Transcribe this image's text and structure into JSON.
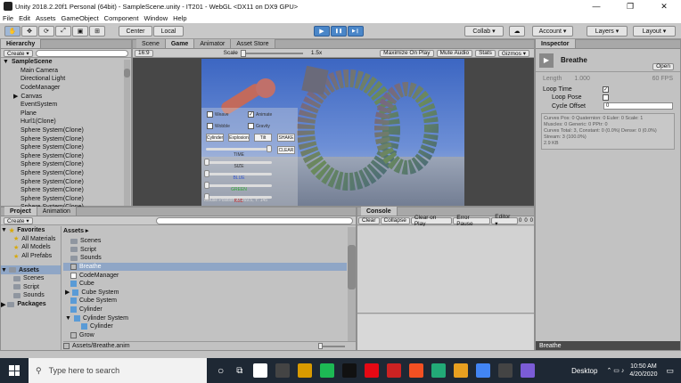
{
  "window": {
    "title": "Unity 2018.2.20f1 Personal (64bit) - SampleScene.unity - IT201 - WebGL <DX11 on DX9 GPU>",
    "min": "—",
    "max": "❐",
    "close": "✕"
  },
  "menu": [
    "File",
    "Edit",
    "Assets",
    "GameObject",
    "Component",
    "Window",
    "Help"
  ],
  "toolbar": {
    "pivot": "Center",
    "space": "Local",
    "collab": "Collab ▾",
    "account": "Account ▾",
    "layers": "Layers ▾",
    "layout": "Layout ▾",
    "cloud_icon": "cloud-icon",
    "play_icon": "▶",
    "pause_icon": "❚❚",
    "step_icon": "▶❙",
    "tool_icons": [
      "✋",
      "✥",
      "⟳",
      "⤢",
      "▣",
      "⊞"
    ]
  },
  "hierarchy": {
    "tab": "Hierarchy",
    "create": "Create ▾",
    "items": [
      {
        "label": "SampleScene",
        "indent": 0,
        "bold": true,
        "arrow": "▼"
      },
      {
        "label": "Main Camera",
        "indent": 1
      },
      {
        "label": "Directional Light",
        "indent": 1
      },
      {
        "label": "CodeManager",
        "indent": 1
      },
      {
        "label": "Canvas",
        "indent": 1,
        "arrow": "▶"
      },
      {
        "label": "EventSystem",
        "indent": 1
      },
      {
        "label": "Plane",
        "indent": 1
      },
      {
        "label": "Hurl1(Clone)",
        "indent": 1
      },
      {
        "label": "Sphere System(Clone)",
        "indent": 1
      },
      {
        "label": "Sphere System(Clone)",
        "indent": 1
      },
      {
        "label": "Sphere System(Clone)",
        "indent": 1
      },
      {
        "label": "Sphere System(Clone)",
        "indent": 1
      },
      {
        "label": "Sphere System(Clone)",
        "indent": 1
      },
      {
        "label": "Sphere System(Clone)",
        "indent": 1
      },
      {
        "label": "Sphere System(Clone)",
        "indent": 1
      },
      {
        "label": "Sphere System(Clone)",
        "indent": 1
      },
      {
        "label": "Sphere System(Clone)",
        "indent": 1
      },
      {
        "label": "Sphere System(Clone)",
        "indent": 1
      }
    ]
  },
  "center_tabs": [
    {
      "label": "Scene",
      "active": false
    },
    {
      "label": "Game",
      "active": true
    },
    {
      "label": "Animator",
      "active": false
    },
    {
      "label": "Asset Store",
      "active": false
    }
  ],
  "game_bar": {
    "aspect": "16:9",
    "scale_label": "Scale",
    "scale_value": "1.5x",
    "buttons": [
      "Maximize On Play",
      "Mute Audio",
      "Stats",
      "Gizmos ▾"
    ]
  },
  "game_ui": {
    "toggles": [
      "Weave",
      "Animate",
      "Wobble",
      "Gravity"
    ],
    "shape_buttons": [
      "Cylinder",
      "Explosion",
      "Tilt",
      "SHAKE"
    ],
    "clear": "CLEAR",
    "sliders": [
      "TIME",
      "SIZE",
      "BLUE",
      "GREEN",
      "RED"
    ],
    "mouse_pos": "Mouse Position X: 369.5, Y: 145"
  },
  "inspector": {
    "tab": "Inspector",
    "name": "Breathe",
    "open": "Open",
    "length_label": "Length",
    "length_value": "1.000",
    "fps": "60 FPS",
    "loop_time": "Loop Time",
    "loop_pose": "Loop Pose",
    "cycle_offset": "Cycle Offset",
    "cycle_value": "0",
    "info": "Curves Pos: 0 Quaternion: 0 Euler: 0 Scale: 1\nMuscles: 0 Generic: 0 PPtr: 0\nCurves Total: 3, Constant: 0 (0.0%) Dense: 0 (0.0%) Stream: 3 (100.0%)\n2.9 KB",
    "footer": "Breathe"
  },
  "bottom_tabs": [
    {
      "label": "Project",
      "active": true
    },
    {
      "label": "Animation",
      "active": false
    }
  ],
  "project": {
    "create": "Create ▾",
    "favorites_label": "Favorites",
    "favorites": [
      "All Materials",
      "All Models",
      "All Prefabs"
    ],
    "assets_label": "Assets",
    "tree": [
      "Scenes",
      "Script",
      "Sounds"
    ],
    "packages": "Packages",
    "breadcrumb": "Assets ▸",
    "list": [
      {
        "label": "Scenes",
        "icon": "folder",
        "indent": 0
      },
      {
        "label": "Script",
        "icon": "folder",
        "indent": 0
      },
      {
        "label": "Sounds",
        "icon": "folder",
        "indent": 0
      },
      {
        "label": "Breathe",
        "icon": "anim",
        "indent": 0,
        "selected": true
      },
      {
        "label": "CodeManager",
        "icon": "script",
        "indent": 0
      },
      {
        "label": "Cube",
        "icon": "cube",
        "indent": 0
      },
      {
        "label": "Cube System",
        "icon": "cube",
        "indent": 0,
        "arrow": "▶"
      },
      {
        "label": "Cube System",
        "icon": "cube",
        "indent": 0
      },
      {
        "label": "Cylinder",
        "icon": "cube",
        "indent": 0
      },
      {
        "label": "Cylinder System",
        "icon": "cube",
        "indent": 0,
        "arrow": "▼"
      },
      {
        "label": "Cylinder",
        "icon": "cube",
        "indent": 1
      },
      {
        "label": "Grow",
        "icon": "anim",
        "indent": 0
      }
    ],
    "footer_path": "Assets/Breathe.anim"
  },
  "console": {
    "tab": "Console",
    "buttons": [
      "Clear",
      "Collapse",
      "Clear on Play",
      "Error Pause",
      "Editor ▾"
    ],
    "counts": [
      "0",
      "0",
      "0"
    ]
  },
  "taskbar": {
    "search": "Type here to search",
    "desktop": "Desktop",
    "time": "10:50 AM",
    "date": "4/20/2020",
    "apps": [
      "#ffffff",
      "#444",
      "#d89a00",
      "#1db954",
      "#111",
      "#e50914",
      "#c22",
      "#f25022",
      "#2a7",
      "#e8a020",
      "#4285f4",
      "#444",
      "#7b5cd6"
    ]
  },
  "colors": {
    "accent": "#4a86c8",
    "selection": "#8fa6c6",
    "sky": "#3c66c2"
  }
}
